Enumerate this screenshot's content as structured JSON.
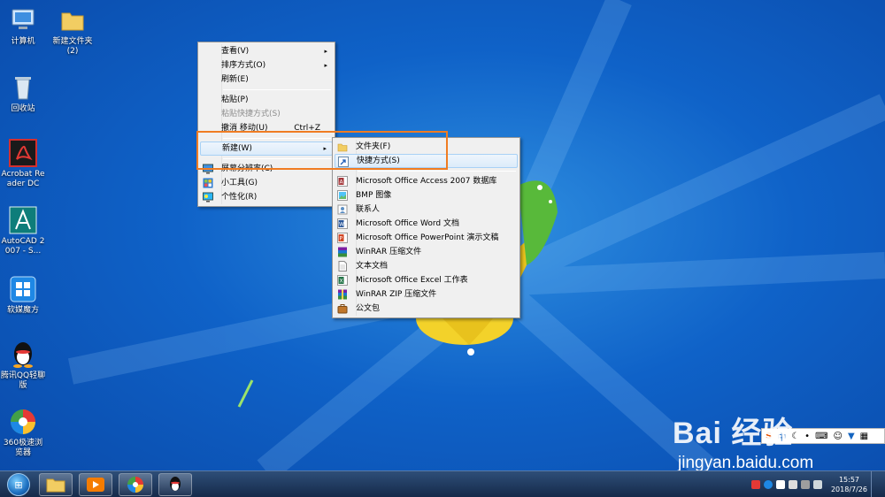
{
  "desktop": {
    "icons": [
      {
        "label": "计算机",
        "icon": "computer-icon"
      },
      {
        "label": "新建文件夹 (2)",
        "icon": "folder-icon"
      },
      {
        "label": "回收站",
        "icon": "recycle-bin-icon"
      },
      {
        "label": "Acrobat Reader DC",
        "icon": "acrobat-icon"
      },
      {
        "label": "AutoCAD 2007 - S...",
        "icon": "autocad-icon"
      },
      {
        "label": "软媒魔方",
        "icon": "rumei-cube-icon"
      },
      {
        "label": "腾讯QQ轻聊版",
        "icon": "qq-icon"
      },
      {
        "label": "360极速浏览器",
        "icon": "360-browser-icon"
      }
    ]
  },
  "context_menu": {
    "items": [
      {
        "label": "查看(V)",
        "arrow": "▸"
      },
      {
        "label": "排序方式(O)",
        "arrow": "▸"
      },
      {
        "label": "刷新(E)"
      },
      {
        "label": "粘贴(P)"
      },
      {
        "label": "粘贴快捷方式(S)"
      },
      {
        "label": "撤消 移动(U)",
        "shortcut": "Ctrl+Z"
      },
      {
        "label": "新建(W)",
        "arrow": "▸"
      },
      {
        "label": "屏幕分辨率(C)"
      },
      {
        "label": "小工具(G)"
      },
      {
        "label": "个性化(R)"
      }
    ]
  },
  "new_submenu": {
    "items": [
      {
        "label": "文件夹(F)"
      },
      {
        "label": "快捷方式(S)"
      },
      {
        "label": "Microsoft Office Access 2007 数据库"
      },
      {
        "label": "BMP 图像"
      },
      {
        "label": "联系人"
      },
      {
        "label": "Microsoft Office Word 文档"
      },
      {
        "label": "Microsoft Office PowerPoint 演示文稿"
      },
      {
        "label": "WinRAR 压缩文件"
      },
      {
        "label": "文本文档"
      },
      {
        "label": "Microsoft Office Excel 工作表"
      },
      {
        "label": "WinRAR ZIP 压缩文件"
      },
      {
        "label": "公文包"
      }
    ]
  },
  "ime_bar": {
    "label": "中",
    "icons": [
      "sogou-s-icon",
      "moon-icon",
      "dot-icon",
      "keyboard-icon",
      "person-icon",
      "shirt-icon",
      "grid-icon"
    ]
  },
  "watermark": {
    "brand": "Bai  经验",
    "url": "jingyan.baidu.com"
  },
  "taskbar": {
    "clock_time": "15:57",
    "clock_date": "2018/7/26"
  },
  "colors": {
    "highlight_box": "#f07c22",
    "desktop": "#1565c0"
  }
}
